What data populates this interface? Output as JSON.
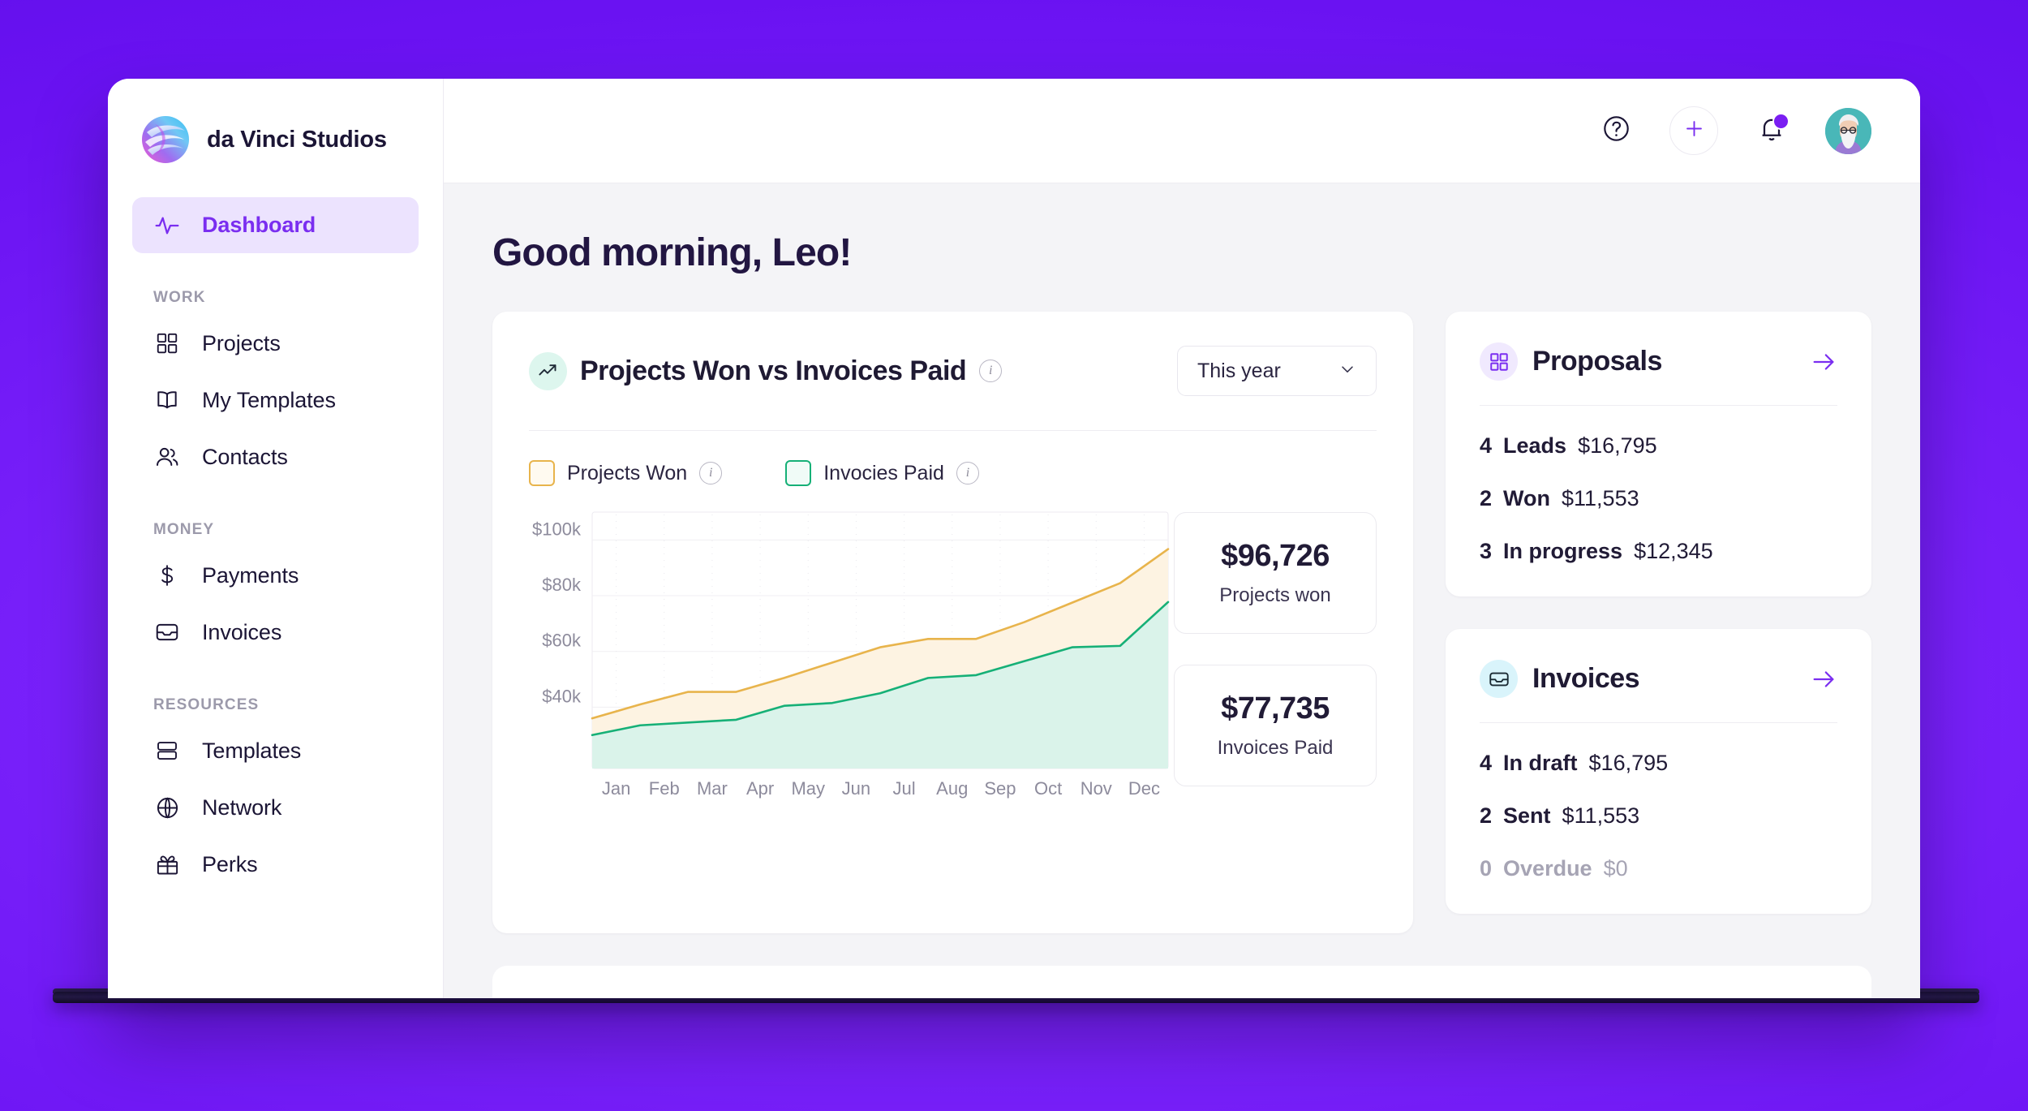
{
  "brand": {
    "name": "da Vinci Studios",
    "logo_icon": "spiral-globe-logo"
  },
  "sidebar": {
    "active_item": {
      "label": "Dashboard",
      "icon": "activity-pulse-icon"
    },
    "groups": [
      {
        "title": "WORK",
        "items": [
          {
            "label": "Projects",
            "icon": "grid-squares-icon"
          },
          {
            "label": "My Templates",
            "icon": "open-book-icon"
          },
          {
            "label": "Contacts",
            "icon": "users-icon"
          }
        ]
      },
      {
        "title": "MONEY",
        "items": [
          {
            "label": "Payments",
            "icon": "dollar-sign-icon"
          },
          {
            "label": "Invoices",
            "icon": "inbox-tray-icon"
          }
        ]
      },
      {
        "title": "RESOURCES",
        "items": [
          {
            "label": "Templates",
            "icon": "stacked-rows-icon"
          },
          {
            "label": "Network",
            "icon": "globe-icon"
          },
          {
            "label": "Perks",
            "icon": "gift-icon"
          }
        ]
      }
    ]
  },
  "topbar": {
    "help_icon": "question-circle-icon",
    "add_icon": "plus-icon",
    "notifications_icon": "bell-icon",
    "has_unread": true,
    "avatar_icon": "user-avatar"
  },
  "main": {
    "greeting": "Good morning, Leo!"
  },
  "chart_card": {
    "icon": "trending-up-icon",
    "title": "Projects Won vs Invoices Paid",
    "title_info_icon": "info-icon",
    "range_select": {
      "value": "This year",
      "chevron_icon": "chevron-down-icon"
    },
    "legend": [
      {
        "label": "Projects Won",
        "color": "#e8b44c",
        "info_icon": "info-icon"
      },
      {
        "label": "Invocies Paid",
        "color": "#16b077",
        "info_icon": "info-icon"
      }
    ],
    "stats": [
      {
        "value": "$96,726",
        "label": "Projects won"
      },
      {
        "value": "$77,735",
        "label": "Invoices Paid"
      }
    ]
  },
  "chart_data": {
    "type": "area",
    "title": "Projects Won vs Invoices Paid",
    "xlabel": "",
    "ylabel": "",
    "x": [
      "Jan",
      "Feb",
      "Mar",
      "Apr",
      "May",
      "Jun",
      "Jul",
      "Aug",
      "Sep",
      "Oct",
      "Nov",
      "Dec"
    ],
    "categories": [
      "Jan",
      "Feb",
      "Mar",
      "Apr",
      "May",
      "Jun",
      "Jul",
      "Aug",
      "Sep",
      "Oct",
      "Nov",
      "Dec"
    ],
    "series": [
      {
        "name": "Projects Won",
        "color": "#e8b44c",
        "fill": "#fdf3e2",
        "values": [
          36000,
          41000,
          45500,
          45500,
          50500,
          56000,
          61500,
          64500,
          64500,
          70500,
          77500,
          84500,
          96726
        ]
      },
      {
        "name": "Invocies Paid",
        "color": "#16b077",
        "fill": "#daf3ea",
        "values": [
          30000,
          33500,
          34500,
          35500,
          40500,
          41500,
          45000,
          50500,
          51500,
          56500,
          61500,
          62000,
          77735
        ]
      }
    ],
    "ytick_labels": [
      "$40k",
      "$60k",
      "$80k",
      "$100k"
    ],
    "ytick_values": [
      40000,
      60000,
      80000,
      100000
    ],
    "ylim": [
      18000,
      110000
    ],
    "grid": true,
    "legend_position": "top-left"
  },
  "proposals_card": {
    "icon": "grid-squares-icon",
    "title": "Proposals",
    "arrow_icon": "arrow-right-icon",
    "rows": [
      {
        "count": "4",
        "label": "Leads",
        "amount": "$16,795",
        "muted": false
      },
      {
        "count": "2",
        "label": "Won",
        "amount": "$11,553",
        "muted": false
      },
      {
        "count": "3",
        "label": "In progress",
        "amount": "$12,345",
        "muted": false
      }
    ]
  },
  "invoices_card": {
    "icon": "inbox-tray-icon",
    "title": "Invoices",
    "arrow_icon": "arrow-right-icon",
    "rows": [
      {
        "count": "4",
        "label": "In draft",
        "amount": "$16,795",
        "muted": false
      },
      {
        "count": "2",
        "label": "Sent",
        "amount": "$11,553",
        "muted": false
      },
      {
        "count": "0",
        "label": "Overdue",
        "amount": "$0",
        "muted": true
      }
    ]
  },
  "colors": {
    "brand_purple": "#7a2ef0",
    "page_background": "#6f19f5",
    "canvas": "#f4f4f7",
    "series_won": "#e8b44c",
    "series_paid": "#16b077",
    "text_dark": "#1f1a33",
    "text_muted": "#a6a4b4"
  }
}
